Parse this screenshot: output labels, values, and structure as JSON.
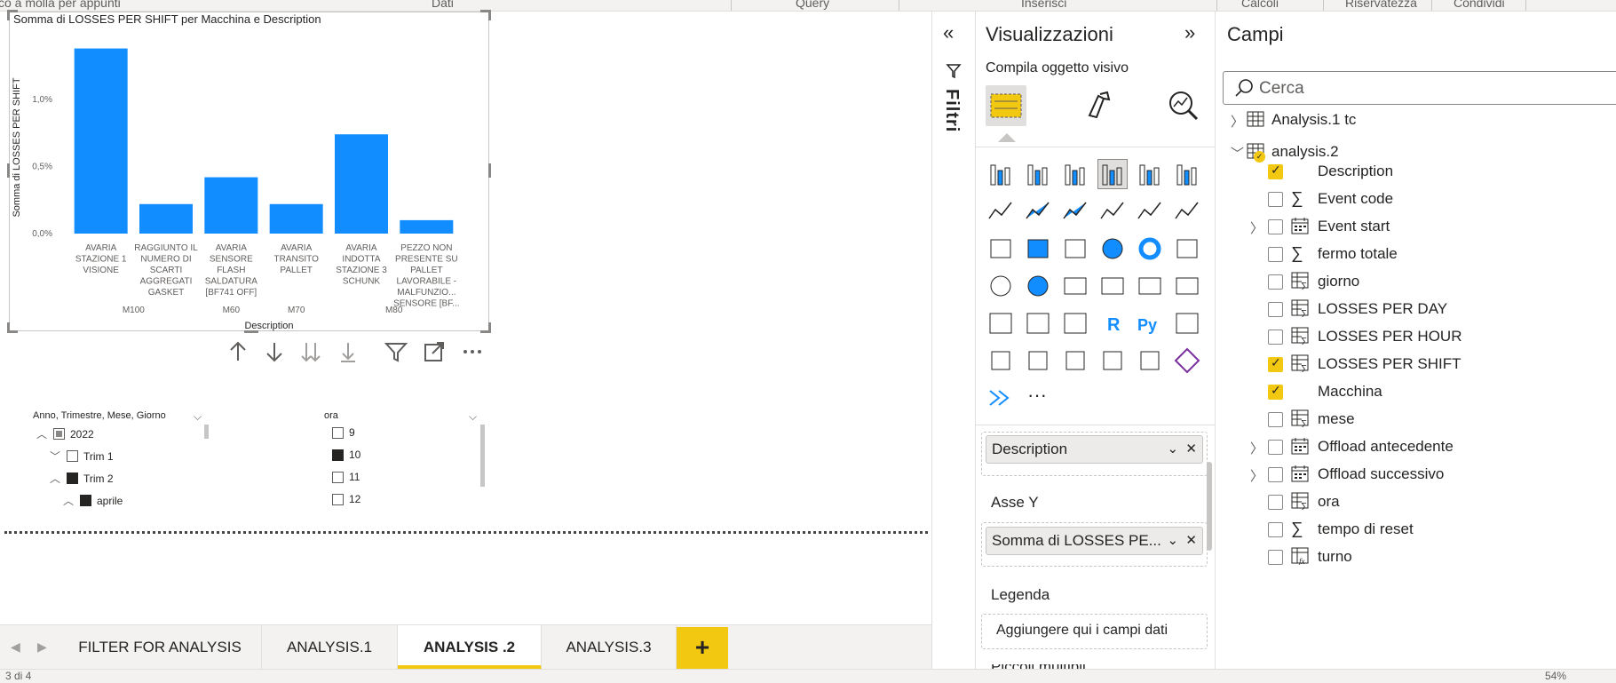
{
  "ribbon": {
    "items": [
      "co a molla per appunti",
      "Dati",
      "Inserisci",
      "Query",
      "Calcoli",
      "Riservatezza",
      "Condividi"
    ]
  },
  "chart": {
    "title": "Somma di LOSSES PER SHIFT per Macchina e Description",
    "x_axis_title": "Description",
    "y_axis_title": "Somma di LOSSES PER SHIFT"
  },
  "chart_data": {
    "type": "bar",
    "title": "Somma di LOSSES PER SHIFT per Macchina e Description",
    "xlabel": "Description",
    "ylabel": "Somma di LOSSES PER SHIFT",
    "ylim": [
      0,
      0.0145
    ],
    "yticks": [
      "0,0%",
      "0,5%",
      "1,0%"
    ],
    "categories": [
      "AVARIA STAZIONE 1 VISIONE",
      "RAGGIUNTO IL NUMERO DI SCARTI AGGREGATI GASKET",
      "AVARIA SENSORE FLASH SALDATURA [BF741 OFF]",
      "AVARIA TRANSITO PALLET",
      "AVARIA INDOTTA STAZIONE 3 SCHUNK",
      "PEZZO NON PRESENTE SU PALLET LAVORABILE - MALFUNZIO... SENSORE [BF..."
    ],
    "category_lines": [
      [
        "AVARIA",
        "STAZIONE 1",
        "VISIONE"
      ],
      [
        "RAGGIUNTO IL",
        "NUMERO DI",
        "SCARTI",
        "AGGREGATI",
        "GASKET"
      ],
      [
        "AVARIA",
        "SENSORE",
        "FLASH",
        "SALDATURA",
        "[BF741 OFF]"
      ],
      [
        "AVARIA",
        "TRANSITO",
        "PALLET"
      ],
      [
        "AVARIA",
        "INDOTTA",
        "STAZIONE 3",
        "SCHUNK"
      ],
      [
        "PEZZO NON",
        "PRESENTE SU",
        "PALLET",
        "LAVORABILE -",
        "MALFUNZIO...",
        "SENSORE [BF..."
      ]
    ],
    "groups": [
      {
        "name": "M100",
        "span": [
          0,
          1
        ]
      },
      {
        "name": "M60",
        "span": [
          2,
          2
        ]
      },
      {
        "name": "M70",
        "span": [
          3,
          3
        ]
      },
      {
        "name": "M80",
        "span": [
          4,
          5
        ]
      }
    ],
    "values": [
      0.0138,
      0.0022,
      0.0042,
      0.0022,
      0.0074,
      0.001
    ],
    "bar_color": "#118dff",
    "grid": false
  },
  "slicer_date": {
    "header": "Anno, Trimestre, Mese, Giorno",
    "items": [
      {
        "label": "2022",
        "state": "partial",
        "expander": "^"
      },
      {
        "label": "Trim 1",
        "state": "empty",
        "expander": "v"
      },
      {
        "label": "Trim 2",
        "state": "filled",
        "expander": "^"
      },
      {
        "label": "aprile",
        "state": "filled",
        "expander": "^"
      }
    ]
  },
  "slicer_ora": {
    "header": "ora",
    "items": [
      {
        "label": "9",
        "state": "empty"
      },
      {
        "label": "10",
        "state": "filled"
      },
      {
        "label": "11",
        "state": "empty"
      },
      {
        "label": "12",
        "state": "empty"
      }
    ]
  },
  "tabs": {
    "items": [
      "FILTER FOR ANALYSIS",
      "ANALYSIS.1",
      "ANALYSIS .2",
      "ANALYSIS.3"
    ],
    "active_index": 2,
    "add_label": "+"
  },
  "filters_pane": {
    "label": "Filtri"
  },
  "viz_pane": {
    "title": "Visualizzazioni",
    "subtitle": "Compila oggetto visivo",
    "more_label": "···",
    "axis_x_value": "Description",
    "axis_y_label": "Asse Y",
    "axis_y_value": "Somma di LOSSES PE...",
    "legend_label": "Legenda",
    "legend_placeholder": "Aggiungere qui i campi dati",
    "cut_label": "Piccoli multipli"
  },
  "fields_pane": {
    "title": "Campi",
    "search_placeholder": "Cerca",
    "tables": [
      {
        "name": "Analysis.1 tc",
        "expanded": false
      },
      {
        "name": "analysis.2",
        "expanded": true
      }
    ],
    "fields": [
      {
        "name": "Description",
        "checked": true,
        "icon": "none",
        "expandable": false
      },
      {
        "name": "Event code",
        "checked": false,
        "icon": "sigma",
        "expandable": false
      },
      {
        "name": "Event start",
        "checked": false,
        "icon": "calendar",
        "expandable": true
      },
      {
        "name": "fermo totale",
        "checked": false,
        "icon": "sigma",
        "expandable": false
      },
      {
        "name": "giorno",
        "checked": false,
        "icon": "calc-table",
        "expandable": false
      },
      {
        "name": "LOSSES PER DAY",
        "checked": false,
        "icon": "calc-table",
        "expandable": false
      },
      {
        "name": "LOSSES PER HOUR",
        "checked": false,
        "icon": "calc-table",
        "expandable": false
      },
      {
        "name": "LOSSES PER SHIFT",
        "checked": true,
        "icon": "calc-table",
        "expandable": false
      },
      {
        "name": "Macchina",
        "checked": true,
        "icon": "none",
        "expandable": false
      },
      {
        "name": "mese",
        "checked": false,
        "icon": "calc-table",
        "expandable": false
      },
      {
        "name": "Offload antecedente",
        "checked": false,
        "icon": "calendar",
        "expandable": true
      },
      {
        "name": "Offload successivo",
        "checked": false,
        "icon": "calendar",
        "expandable": true
      },
      {
        "name": "ora",
        "checked": false,
        "icon": "calc-table",
        "expandable": false
      },
      {
        "name": "tempo di reset",
        "checked": false,
        "icon": "sigma",
        "expandable": false
      },
      {
        "name": "turno",
        "checked": false,
        "icon": "fx-table",
        "expandable": false
      }
    ]
  },
  "statusbar": {
    "left": "3 di 4",
    "right": "54%"
  },
  "colors": {
    "accent": "#f2c811",
    "bar": "#118dff"
  }
}
